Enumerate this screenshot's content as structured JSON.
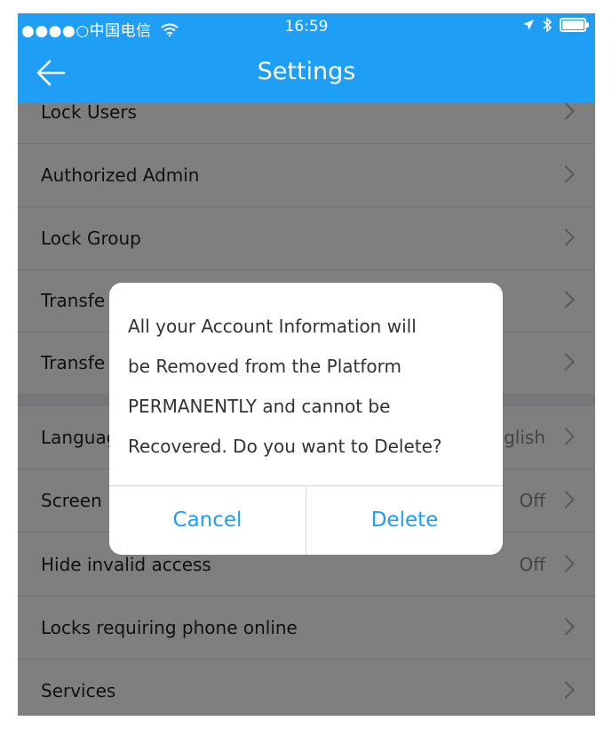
{
  "status_bar": {
    "carrier": "●●●●○中国电信",
    "wifi_icon": "wifi-icon",
    "time": "16:59",
    "location_icon": "location-arrow-icon",
    "bluetooth_icon": "bluetooth-icon",
    "battery_icon": "battery-icon"
  },
  "nav": {
    "title": "Settings",
    "back_icon": "back-arrow-icon"
  },
  "settings": {
    "items": [
      {
        "label": "Lock Users",
        "value": ""
      },
      {
        "label": "Authorized Admin",
        "value": ""
      },
      {
        "label": "Lock Group",
        "value": ""
      },
      {
        "label": "Transfe",
        "value": ""
      },
      {
        "label": "Transfe",
        "value": ""
      },
      {
        "label": "Languag",
        "value": "glish"
      },
      {
        "label": "Screen",
        "value": "Off"
      },
      {
        "label": "Hide invalid access",
        "value": "Off"
      },
      {
        "label": "Locks requiring phone online",
        "value": ""
      },
      {
        "label": "Services",
        "value": ""
      }
    ]
  },
  "dialog": {
    "message_lines": [
      "All your Account Information will",
      "be Removed from the Platform",
      "PERMANENTLY and cannot be",
      "Recovered. Do you want to Delete?"
    ],
    "cancel_label": "Cancel",
    "delete_label": "Delete"
  },
  "colors": {
    "accent": "#1e9ef5",
    "overlay": "rgba(0,0,0,0.5)"
  }
}
